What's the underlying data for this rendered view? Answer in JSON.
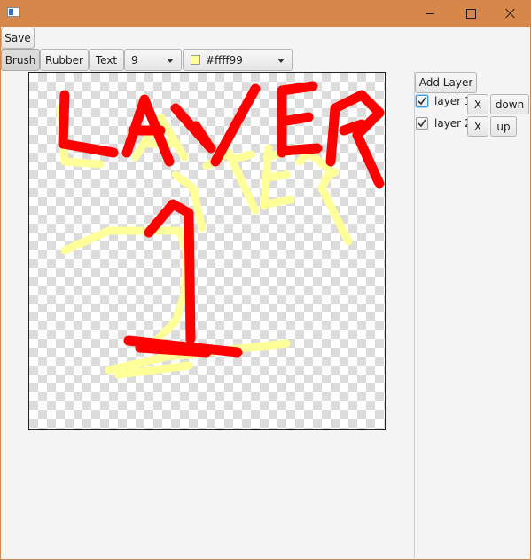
{
  "window": {
    "title": ""
  },
  "toolbar": {
    "save_label": "Save",
    "tools": [
      {
        "label": "Brush",
        "selected": true
      },
      {
        "label": "Rubber",
        "selected": false
      },
      {
        "label": "Text",
        "selected": false
      }
    ],
    "brush_size": "9",
    "color_value": "#ffff99",
    "color_swatch": "#ffff99"
  },
  "layers_panel": {
    "add_layer_label": "Add Layer",
    "layers": [
      {
        "name": "layer 1",
        "checked": true,
        "focused": true,
        "remove_label": "X",
        "move_label": "down"
      },
      {
        "name": "layer 2",
        "checked": true,
        "focused": false,
        "remove_label": "X",
        "move_label": "up"
      }
    ]
  },
  "canvas": {
    "layer_colors": {
      "layer1": "#ff0000",
      "layer2": "#ffff99"
    }
  }
}
